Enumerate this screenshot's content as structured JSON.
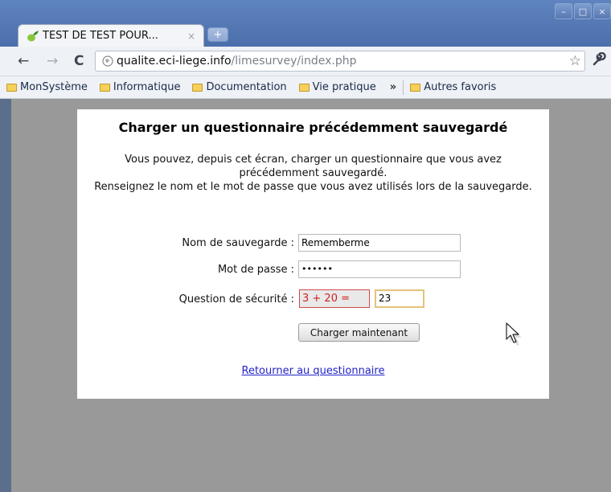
{
  "tab": {
    "title": "TEST DE TEST POUR...",
    "close": "×",
    "new_tab": "+"
  },
  "window_controls": {
    "minimize": "–",
    "maximize": "□",
    "close": "×"
  },
  "nav": {
    "back": "←",
    "forward": "→",
    "reload": "C",
    "star": "☆",
    "wrench": "🔧"
  },
  "url": {
    "host": "qualite.eci-liege.info",
    "path": "/limesurvey/index.php"
  },
  "bookmarks": [
    "MonSystème",
    "Informatique",
    "Documentation",
    "Vie pratique"
  ],
  "bookmarks_more": "»",
  "bookmarks_other": "Autres favoris",
  "page": {
    "title": "Charger un questionnaire précédemment sauvegardé",
    "desc1": "Vous pouvez, depuis cet écran, charger un questionnaire que vous avez précédemment sauvegardé.",
    "desc2": "Renseignez le nom et le mot de passe que vous avez utilisés lors de la sauvegarde.",
    "name_label": "Nom de sauvegarde :",
    "name_value": "Rememberme",
    "password_label": "Mot de passe :",
    "password_value": "••••••",
    "security_label": "Question de sécurité :",
    "captcha": "3 + 20 =",
    "captcha_answer": "23",
    "load_button": "Charger maintenant",
    "return_link": "Retourner au questionnaire"
  },
  "colors": {
    "page_bg": "#999999",
    "link": "#2323c8",
    "captcha_text": "#d02020",
    "titlebar": "#5f84c0"
  }
}
